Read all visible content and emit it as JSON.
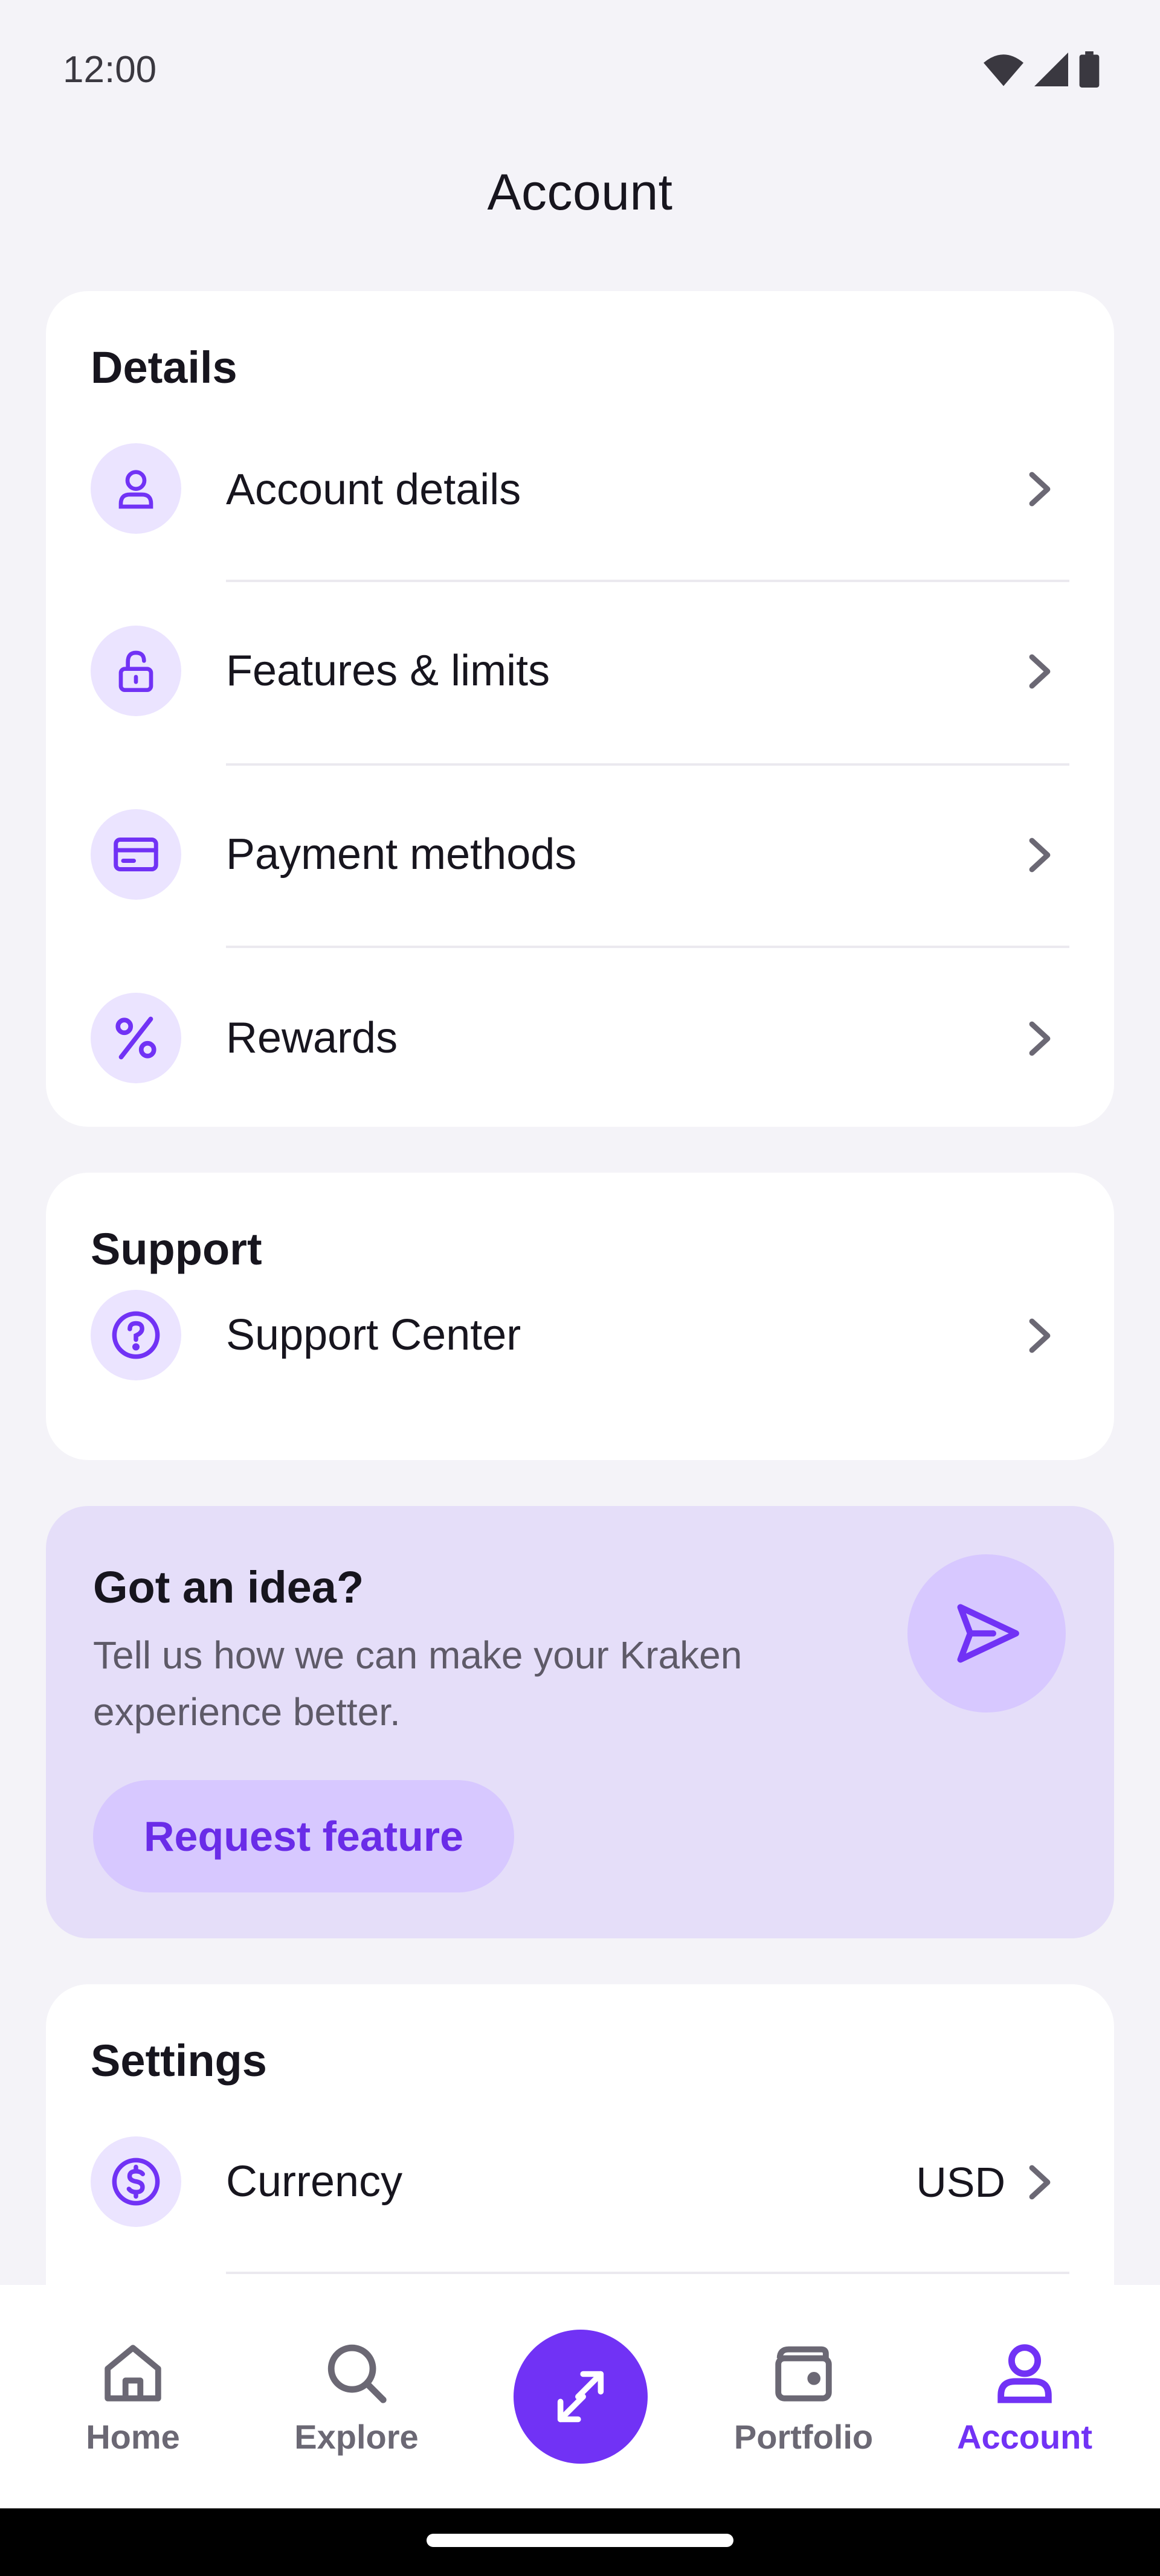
{
  "status_bar": {
    "time": "12:00"
  },
  "header": {
    "title": "Account"
  },
  "details": {
    "heading": "Details",
    "items": [
      {
        "label": "Account details",
        "icon": "user-icon"
      },
      {
        "label": "Features & limits",
        "icon": "unlock-icon"
      },
      {
        "label": "Payment methods",
        "icon": "credit-card-icon"
      },
      {
        "label": "Rewards",
        "icon": "percent-icon"
      }
    ]
  },
  "support": {
    "heading": "Support",
    "items": [
      {
        "label": "Support Center",
        "icon": "help-icon"
      }
    ]
  },
  "idea": {
    "title": "Got an idea?",
    "text": "Tell us how we can make your Kraken experience better.",
    "button": "Request feature"
  },
  "settings": {
    "heading": "Settings",
    "items": [
      {
        "label": "Currency",
        "value": "USD",
        "icon": "dollar-icon"
      }
    ]
  },
  "bottom_nav": {
    "items": [
      {
        "label": "Home",
        "icon": "home-icon"
      },
      {
        "label": "Explore",
        "icon": "search-icon"
      },
      {
        "label": "Portfolio",
        "icon": "wallet-icon"
      },
      {
        "label": "Account",
        "icon": "user-icon",
        "active": true
      }
    ]
  },
  "colors": {
    "accent": "#7132f5",
    "accent_light": "#ebe4ff",
    "idea_bg": "#e5def9",
    "background": "#f4f3f8"
  }
}
